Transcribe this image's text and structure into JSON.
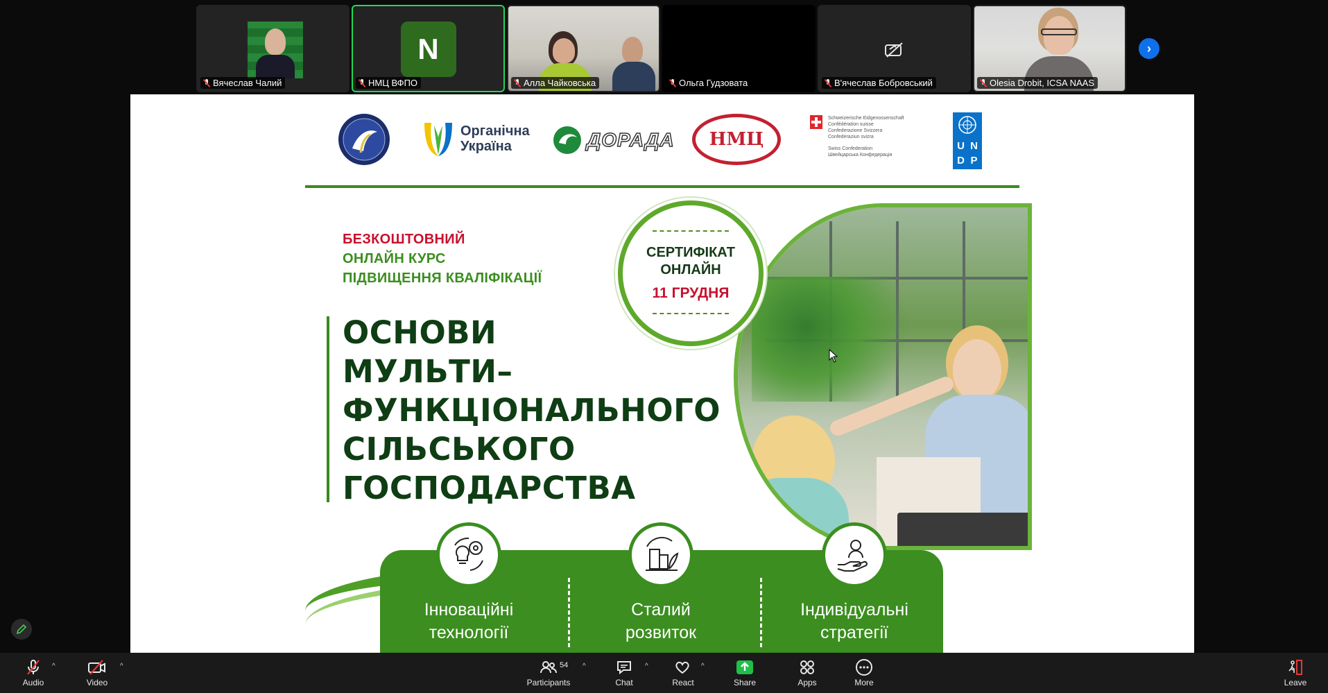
{
  "participants": [
    {
      "name": "Вячеслав Чалий"
    },
    {
      "name": "НМЦ ВФПО",
      "initial": "N"
    },
    {
      "name": "Алла Чайковська"
    },
    {
      "name": "Ольга Гудзовата"
    },
    {
      "name": "В'ячеслав Бобровський"
    },
    {
      "name": "Olesia Drobit, ICSA NAAS"
    }
  ],
  "logos": {
    "organic_line1": "Органічна",
    "organic_line2": "Україна",
    "dorada": "ДОРАДА",
    "nmc": "НМЦ",
    "swiss_lines": [
      "Schweizerische Eidgenossenschaft",
      "Confédération suisse",
      "Confederazione Svizzera",
      "Confederaziun svizra",
      "Swiss Confederation",
      "Швейцарська Конфедерація"
    ],
    "undp": [
      "U",
      "N",
      "D",
      "P"
    ]
  },
  "slide": {
    "eyebrow1": "БЕЗКОШТОВНИЙ",
    "eyebrow2": "ОНЛАЙН КУРС",
    "eyebrow3": "ПІДВИЩЕННЯ КВАЛІФІКАЦІЇ",
    "title": [
      "ОСНОВИ",
      "МУЛЬТИ–",
      "ФУНКЦІОНАЛЬНОГО",
      "СІЛЬСЬКОГО",
      "ГОСПОДАРСТВА"
    ],
    "cert_line1": "СЕРТИФІКАТ",
    "cert_line2": "ОНЛАЙН",
    "cert_date": "11 ГРУДНЯ",
    "features": [
      {
        "line1": "Інноваційні",
        "line2": "технології"
      },
      {
        "line1": "Сталий",
        "line2": "розвиток"
      },
      {
        "line1": "Індивідуальні",
        "line2": "стратегії"
      }
    ],
    "colors": {
      "red": "#c8102e",
      "green": "#3b8e1f",
      "dark_green": "#0f3d14"
    }
  },
  "toolbar": {
    "audio": "Audio",
    "video": "Video",
    "participants": "Participants",
    "participants_count": "54",
    "chat": "Chat",
    "react": "React",
    "share": "Share",
    "apps": "Apps",
    "more": "More",
    "leave": "Leave"
  }
}
